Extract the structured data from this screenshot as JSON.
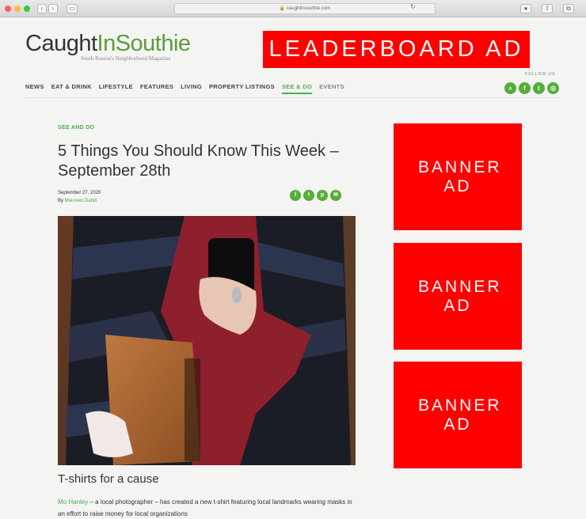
{
  "browser": {
    "url": "caughtinsouthie.com"
  },
  "site": {
    "logo": {
      "part1": "Caught",
      "part2": "In",
      "part3": "Southie",
      "tagline": "South Boston's Neighborhood Magazine"
    },
    "leaderboard_ad": "LEADERBOARD AD",
    "follow_label": "FOLLOW US",
    "nav": [
      "NEWS",
      "EAT & DRINK",
      "LIFESTYLE",
      "FEATURES",
      "LIVING",
      "PROPERTY LISTINGS",
      "SEE & DO",
      "EVENTS"
    ],
    "active_nav": "SEE & DO",
    "social_icons": [
      "search-icon",
      "facebook-icon",
      "twitter-icon",
      "instagram-icon"
    ]
  },
  "article": {
    "category": "SEE AND DO",
    "title": "5 Things You Should Know This Week – September 28th",
    "date": "September 27, 2020",
    "by_prefix": "By",
    "author": "Maureen Dahill",
    "share_icons": [
      "facebook-icon",
      "twitter-icon",
      "pinterest-icon",
      "email-icon"
    ],
    "subheading": "T-shirts for a cause",
    "body_link": "Mo Hanley",
    "body_text": " – a local photographer –  has created a new t-shirt featuring local landmarks wearing masks in an effort to raise money for local organizations"
  },
  "banners": [
    "BANNER AD",
    "BANNER AD",
    "BANNER AD"
  ],
  "colors": {
    "accent": "#4caf50",
    "ad_red": "#ff0000",
    "logo_green": "#5d9c3a"
  }
}
